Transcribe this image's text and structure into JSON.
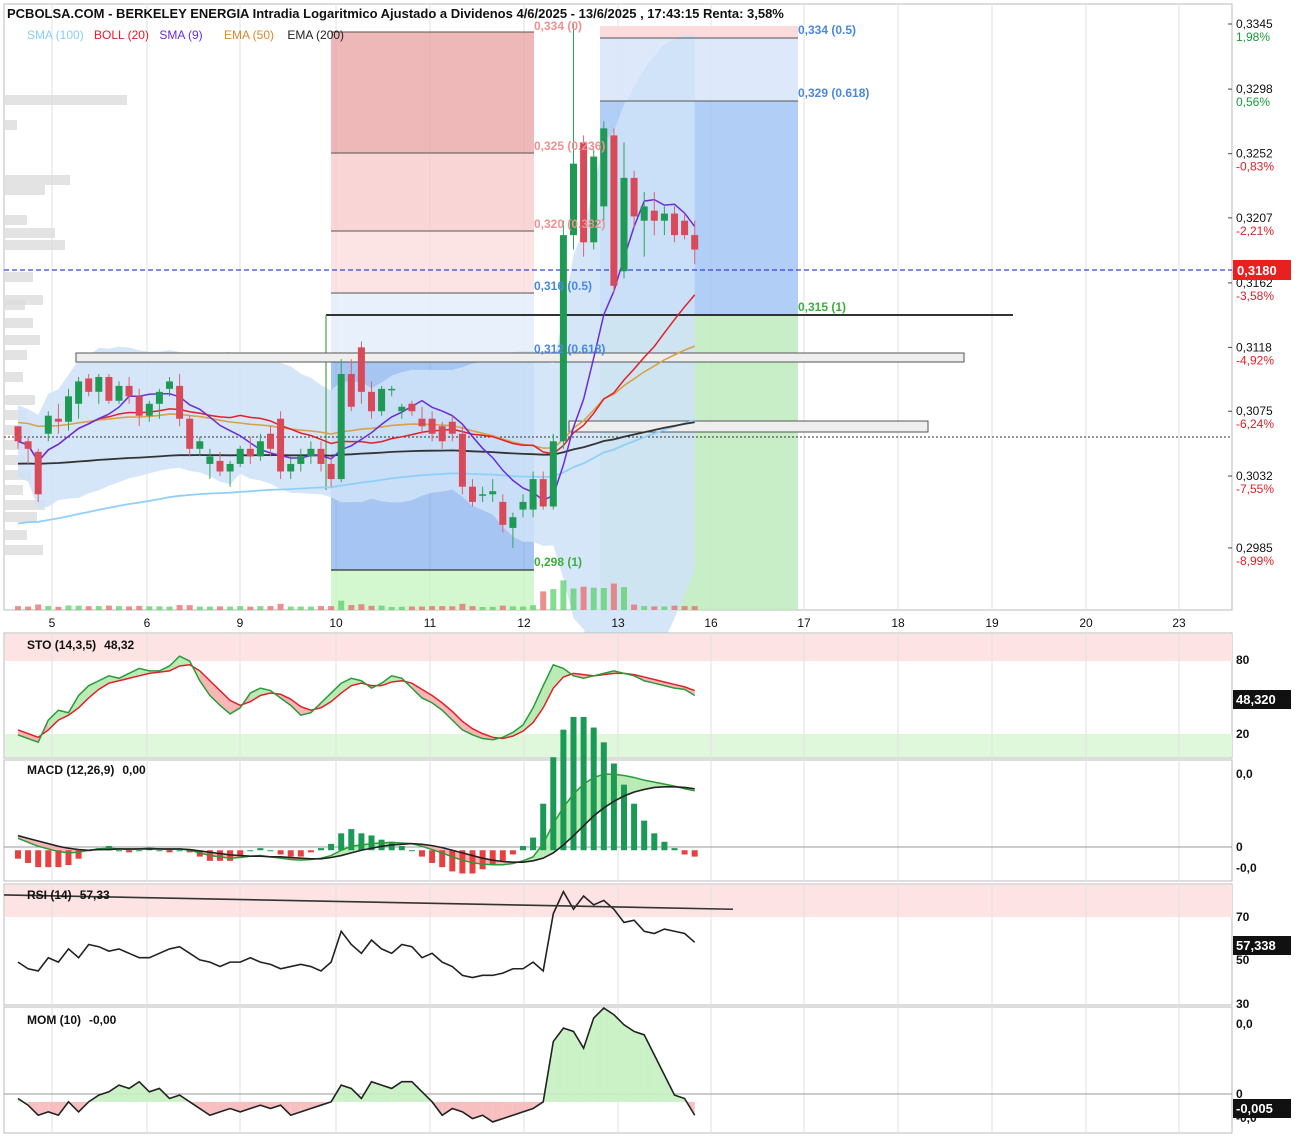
{
  "header": {
    "title": "PCBOLSA.COM - BERKELEY ENERGIA Intradia Logaritmico Ajustado a Dividenos 4/6/2025 - 13/6/2025 , 17:43:15 Renta: 3,58%",
    "legend": [
      {
        "label": "SMA (100)",
        "color": "#87cefa"
      },
      {
        "label": "BOLL (20)",
        "color": "#e0202a"
      },
      {
        "label": "SMA (9)",
        "color": "#6a2bd8"
      },
      {
        "label": "EMA (50)",
        "color": "#d88a2a"
      },
      {
        "label": "EMA (200)",
        "color": "#222222"
      }
    ]
  },
  "chart_data": [
    {
      "type": "candlestick",
      "name_shown": "price",
      "x_ticks": [
        "5",
        "6",
        "9",
        "10",
        "11",
        "12",
        "13",
        "16",
        "17",
        "18",
        "19",
        "20",
        "23"
      ],
      "price_axis": [
        {
          "price": "0,3345",
          "pct": "1,98%",
          "color": "#1a9a3a"
        },
        {
          "price": "0,3298",
          "pct": "0,56%",
          "color": "#1a9a3a"
        },
        {
          "price": "0,3252",
          "pct": "-0,83%",
          "color": "#e0202a"
        },
        {
          "price": "0,3207",
          "pct": "-2,21%",
          "color": "#e0202a"
        },
        {
          "price": "0,3162",
          "pct": "-3,58%",
          "color": "#e0202a"
        },
        {
          "price": "0,3118",
          "pct": "-4,92%",
          "color": "#e0202a"
        },
        {
          "price": "0,3075",
          "pct": "-6,24%",
          "color": "#e0202a"
        },
        {
          "price": "0,3032",
          "pct": "-7,55%",
          "color": "#e0202a"
        },
        {
          "price": "0,2985",
          "pct": "-8,99%",
          "color": "#e0202a"
        }
      ],
      "ylim": [
        0.2945,
        0.3345
      ],
      "scale": "log",
      "last_price": "0,3180",
      "candles": [
        [
          0.3065,
          0.3065,
          0.305,
          0.3055
        ],
        [
          0.3055,
          0.3058,
          0.304,
          0.305
        ],
        [
          0.3048,
          0.305,
          0.3015,
          0.302
        ],
        [
          0.306,
          0.3075,
          0.3055,
          0.3072
        ],
        [
          0.307,
          0.308,
          0.306,
          0.3068
        ],
        [
          0.3068,
          0.309,
          0.3062,
          0.3085
        ],
        [
          0.308,
          0.3098,
          0.307,
          0.3095
        ],
        [
          0.3097,
          0.31,
          0.3085,
          0.3088
        ],
        [
          0.3088,
          0.31,
          0.308,
          0.3098
        ],
        [
          0.3098,
          0.31,
          0.308,
          0.3082
        ],
        [
          0.3082,
          0.3095,
          0.308,
          0.3092
        ],
        [
          0.3092,
          0.3098,
          0.308,
          0.3085
        ],
        [
          0.3085,
          0.309,
          0.3065,
          0.3072
        ],
        [
          0.3072,
          0.3082,
          0.3068,
          0.308
        ],
        [
          0.308,
          0.309,
          0.307,
          0.3088
        ],
        [
          0.309,
          0.3098,
          0.3085,
          0.3095
        ],
        [
          0.3092,
          0.31,
          0.3065,
          0.307
        ],
        [
          0.307,
          0.3072,
          0.3045,
          0.305
        ],
        [
          0.305,
          0.3058,
          0.3045,
          0.3055
        ],
        [
          0.304,
          0.305,
          0.303,
          0.3045
        ],
        [
          0.3042,
          0.3048,
          0.3032,
          0.3035
        ],
        [
          0.3035,
          0.3042,
          0.3025,
          0.304
        ],
        [
          0.304,
          0.3052,
          0.3038,
          0.305
        ],
        [
          0.305,
          0.3058,
          0.304,
          0.3045
        ],
        [
          0.3045,
          0.306,
          0.3042,
          0.3055
        ],
        [
          0.306,
          0.3065,
          0.3045,
          0.305
        ],
        [
          0.307,
          0.3075,
          0.303,
          0.3035
        ],
        [
          0.3035,
          0.3045,
          0.303,
          0.304
        ],
        [
          0.304,
          0.305,
          0.3035,
          0.3045
        ],
        [
          0.3045,
          0.3055,
          0.304,
          0.305
        ],
        [
          0.305,
          0.3055,
          0.3035,
          0.304
        ],
        [
          0.304,
          0.3045,
          0.3025,
          0.303
        ],
        [
          0.303,
          0.311,
          0.3028,
          0.31
        ],
        [
          0.31,
          0.311,
          0.3075,
          0.3078
        ],
        [
          0.3118,
          0.3122,
          0.308,
          0.3088
        ],
        [
          0.3088,
          0.3095,
          0.307,
          0.3075
        ],
        [
          0.3075,
          0.3092,
          0.3072,
          0.309
        ],
        [
          0.309,
          0.3092,
          0.3085,
          0.309
        ],
        [
          0.3075,
          0.308,
          0.307,
          0.3078
        ],
        [
          0.308,
          0.3082,
          0.3072,
          0.3075
        ],
        [
          0.307,
          0.3078,
          0.306,
          0.3065
        ],
        [
          0.307,
          0.3075,
          0.3055,
          0.306
        ],
        [
          0.3065,
          0.3068,
          0.305,
          0.3055
        ],
        [
          0.3068,
          0.3072,
          0.3055,
          0.306
        ],
        [
          0.306,
          0.3065,
          0.302,
          0.3025
        ],
        [
          0.3025,
          0.303,
          0.3012,
          0.3015
        ],
        [
          0.302,
          0.3025,
          0.3015,
          0.302
        ],
        [
          0.302,
          0.303,
          0.3015,
          0.3022
        ],
        [
          0.3015,
          0.302,
          0.2995,
          0.3
        ],
        [
          0.2998,
          0.3008,
          0.2985,
          0.3005
        ],
        [
          0.301,
          0.302,
          0.3005,
          0.3015
        ],
        [
          0.301,
          0.3035,
          0.3005,
          0.303
        ],
        [
          0.303,
          0.3035,
          0.301,
          0.3012
        ],
        [
          0.3012,
          0.306,
          0.301,
          0.3055
        ],
        [
          0.3055,
          0.3205,
          0.305,
          0.3195
        ],
        [
          0.3195,
          0.3345,
          0.3185,
          0.3245
        ],
        [
          0.326,
          0.3265,
          0.318,
          0.319
        ],
        [
          0.319,
          0.3255,
          0.3185,
          0.325
        ],
        [
          0.3215,
          0.3275,
          0.3205,
          0.327
        ],
        [
          0.3265,
          0.327,
          0.3155,
          0.316
        ],
        [
          0.317,
          0.326,
          0.3165,
          0.3235
        ],
        [
          0.3235,
          0.324,
          0.32,
          0.3208
        ],
        [
          0.3205,
          0.3225,
          0.318,
          0.3215
        ],
        [
          0.3212,
          0.3225,
          0.3195,
          0.3205
        ],
        [
          0.3205,
          0.3215,
          0.3195,
          0.321
        ],
        [
          0.321,
          0.3215,
          0.319,
          0.3195
        ],
        [
          0.3205,
          0.321,
          0.3192,
          0.3195
        ],
        [
          0.3195,
          0.3205,
          0.3175,
          0.3185
        ]
      ],
      "fibonacci": [
        {
          "label": "0,334 (0)"
        },
        {
          "label": "0,325 (0.236)"
        },
        {
          "label": "0,320 (0.382)"
        },
        {
          "label": "0,316 (0.5)"
        },
        {
          "label": "0,312 (0.618)"
        },
        {
          "label": "0,298 (1)"
        },
        {
          "label": "0,334 (0.5)"
        },
        {
          "label": "0,329 (0.618)"
        },
        {
          "label": "0,315 (1)"
        }
      ]
    },
    {
      "type": "line",
      "name": "STO (14,3,5)",
      "value": "48,32",
      "last": "48,320",
      "levels": [
        "80",
        "20"
      ],
      "ylim": [
        0,
        100
      ],
      "series": [
        {
          "values": [
            18,
            15,
            12,
            30,
            38,
            36,
            50,
            58,
            62,
            66,
            64,
            68,
            72,
            70,
            70,
            74,
            82,
            78,
            62,
            50,
            42,
            35,
            40,
            52,
            56,
            54,
            48,
            42,
            34,
            36,
            44,
            52,
            60,
            64,
            62,
            56,
            60,
            66,
            64,
            56,
            48,
            44,
            38,
            30,
            22,
            18,
            15,
            14,
            16,
            20,
            26,
            40,
            58,
            75,
            72,
            66,
            64,
            66,
            68,
            70,
            68,
            66,
            62,
            60,
            58,
            56,
            55,
            50
          ]
        },
        {
          "values": [
            22,
            19,
            16,
            22,
            30,
            34,
            40,
            48,
            55,
            60,
            62,
            64,
            66,
            68,
            69,
            70,
            74,
            75,
            70,
            62,
            54,
            46,
            42,
            45,
            50,
            52,
            51,
            47,
            41,
            38,
            40,
            45,
            52,
            58,
            60,
            58,
            58,
            61,
            62,
            60,
            55,
            50,
            44,
            37,
            29,
            23,
            19,
            16,
            15,
            17,
            21,
            28,
            40,
            56,
            65,
            68,
            67,
            66,
            67,
            68,
            68,
            67,
            65,
            63,
            61,
            59,
            57,
            54
          ]
        }
      ]
    },
    {
      "type": "line",
      "name": "MACD (12,26,9)",
      "value": "0,00",
      "labels": [
        "0,0",
        "0",
        "-0,0"
      ],
      "ylim": [
        -0.0045,
        0.0135
      ],
      "series": [
        {
          "values": [
            0.0018,
            0.0012,
            0.0006,
            0.0002,
            -0.0002,
            -0.0004,
            -0.0003,
            0.0,
            0.0002,
            0.0003,
            0.0002,
            0.0001,
            0.0002,
            0.0003,
            0.0002,
            0.0001,
            0.0002,
            0.0,
            -0.0004,
            -0.0008,
            -0.001,
            -0.0012,
            -0.0011,
            -0.0009,
            -0.0008,
            -0.001,
            -0.0012,
            -0.0014,
            -0.0015,
            -0.0014,
            -0.0012,
            -0.0008,
            0.0,
            0.0006,
            0.0008,
            0.001,
            0.0011,
            0.0012,
            0.0011,
            0.001,
            0.0006,
            0.0001,
            -0.0004,
            -0.001,
            -0.0015,
            -0.0019,
            -0.0021,
            -0.0022,
            -0.0022,
            -0.002,
            -0.0016,
            -0.001,
            0.001,
            0.004,
            0.0065,
            0.0085,
            0.01,
            0.011,
            0.0115,
            0.0115,
            0.0113,
            0.011,
            0.0106,
            0.0103,
            0.01,
            0.0097,
            0.0093,
            0.009
          ]
        },
        {
          "values": [
            0.0022,
            0.0018,
            0.0014,
            0.001,
            0.0006,
            0.0003,
            0.0001,
            0.0,
            0.0001,
            0.0001,
            0.0002,
            0.0002,
            0.0002,
            0.0002,
            0.0002,
            0.0002,
            0.0002,
            0.0001,
            -0.0001,
            -0.0003,
            -0.0005,
            -0.0007,
            -0.0008,
            -0.0009,
            -0.0009,
            -0.001,
            -0.001,
            -0.0011,
            -0.0012,
            -0.0013,
            -0.0013,
            -0.0011,
            -0.0008,
            -0.0004,
            0.0,
            0.0003,
            0.0006,
            0.0008,
            0.0009,
            0.001,
            0.0009,
            0.0007,
            0.0004,
            0.0,
            -0.0004,
            -0.0008,
            -0.0012,
            -0.0015,
            -0.0017,
            -0.0018,
            -0.0018,
            -0.0016,
            -0.0012,
            -0.0004,
            0.0008,
            0.0022,
            0.0037,
            0.0052,
            0.0064,
            0.0074,
            0.0082,
            0.0088,
            0.0092,
            0.0095,
            0.0096,
            0.0096,
            0.0095,
            0.0093
          ]
        }
      ]
    },
    {
      "type": "line",
      "name": "RSI (14)",
      "value": "57,33",
      "last": "57,338",
      "levels": [
        "70",
        "50",
        "30"
      ],
      "ylim": [
        29,
        83
      ],
      "series": [
        {
          "values": [
            48,
            45,
            44,
            50,
            48,
            54,
            50,
            56,
            55,
            53,
            54,
            52,
            50,
            50,
            52,
            54,
            55,
            52,
            49,
            48,
            46,
            48,
            48,
            50,
            48,
            47,
            45,
            46,
            47,
            46,
            44,
            48,
            62,
            56,
            52,
            58,
            54,
            52,
            56,
            55,
            50,
            52,
            48,
            46,
            42,
            41,
            42,
            42,
            43,
            45,
            45,
            48,
            44,
            70,
            80,
            72,
            78,
            74,
            76,
            72,
            66,
            67,
            62,
            61,
            63,
            62,
            61,
            57
          ]
        },
        {
          "values": [
            78.5,
            72
          ]
        }
      ]
    },
    {
      "type": "area",
      "name": "MOM (10)",
      "value": "-0,00",
      "last": "-0,005",
      "labels": [
        "0,0",
        "0",
        "-0,0"
      ],
      "ylim": [
        -0.009,
        0.028
      ],
      "series": [
        {
          "values": [
            0.001,
            -0.001,
            -0.004,
            -0.003,
            -0.004,
            0.0,
            -0.003,
            0.0,
            0.002,
            0.003,
            0.005,
            0.004,
            0.006,
            0.003,
            0.004,
            0.001,
            0.002,
            0.0,
            -0.002,
            -0.004,
            -0.003,
            -0.002,
            -0.003,
            -0.002,
            -0.001,
            -0.002,
            -0.001,
            -0.004,
            -0.003,
            -0.002,
            -0.001,
            0.0,
            0.005,
            0.004,
            0.001,
            0.006,
            0.005,
            0.004,
            0.006,
            0.006,
            0.003,
            0.0,
            -0.004,
            -0.002,
            -0.003,
            -0.005,
            -0.004,
            -0.006,
            -0.005,
            -0.004,
            -0.003,
            -0.002,
            0.0,
            0.018,
            0.022,
            0.021,
            0.016,
            0.025,
            0.028,
            0.026,
            0.023,
            0.021,
            0.02,
            0.014,
            0.008,
            0.002,
            0.001,
            -0.004
          ]
        }
      ]
    }
  ]
}
